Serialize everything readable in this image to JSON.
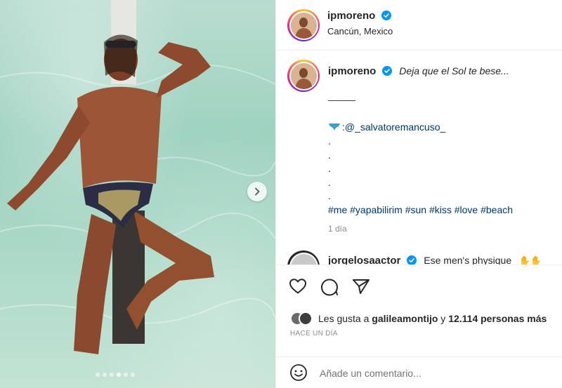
{
  "post": {
    "username": "ipmoreno",
    "location": "Cancún, Mexico",
    "verified": true,
    "image_count": 6,
    "active_image": 4
  },
  "caption": {
    "username": "ipmoreno",
    "text": "Deja que el Sol te bese...",
    "separator": "_____",
    "mention_prefix": ": ",
    "mention": "@_salvatoremancuso_",
    "dots": [
      ".",
      ".",
      ".",
      ".",
      "."
    ],
    "hashtags": "#me #yapabilirim #sun #kiss #love #beach",
    "time": "1 día"
  },
  "next_comment": {
    "username": "jorgelosaactor",
    "text": "Ese men's physique"
  },
  "actions": {
    "like_icon": "heart-icon",
    "comment_icon": "comment-icon",
    "share_icon": "paper-plane-icon"
  },
  "likes": {
    "prefix": "Les gusta a",
    "user": "galileamontijo",
    "conjunction": "y",
    "count": "12.114 personas más"
  },
  "timestamp": "HACE UN DÍA",
  "comment_box": {
    "emoji_icon": "smiley-icon",
    "placeholder": "Añade un comentario..."
  },
  "colors": {
    "link": "#00376b",
    "verified": "#0095f6",
    "muted": "#8e8e8e",
    "text": "#262626"
  }
}
